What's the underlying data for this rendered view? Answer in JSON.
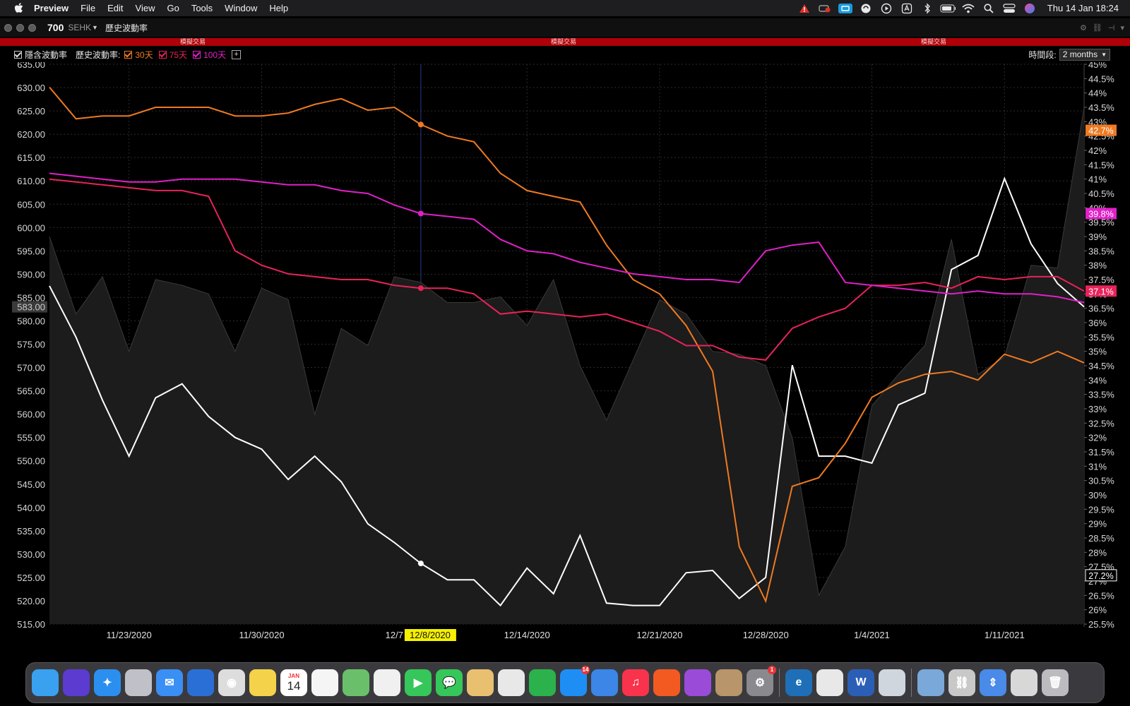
{
  "menubar": {
    "app_name": "Preview",
    "items": [
      "File",
      "Edit",
      "View",
      "Go",
      "Tools",
      "Window",
      "Help"
    ],
    "status_icons": [
      "warning-icon",
      "battery-status-icon",
      "screen-mirror-icon",
      "sync-icon",
      "play-icon",
      "app-store-icon",
      "bluetooth-icon",
      "battery-icon",
      "wifi-icon",
      "search-icon",
      "control-center-icon",
      "siri-icon"
    ],
    "clock": "Thu 14 Jan  18:24"
  },
  "window": {
    "symbol": "700",
    "exchange": "SEHK",
    "panel_title": "歷史波動率",
    "banner_label": "模擬交易"
  },
  "toolbar": {
    "implied_vol_label": "隱含波動率",
    "historical_vol_label": "歷史波動率:",
    "vol_30_label": "30天",
    "vol_75_label": "75天",
    "vol_100_label": "100天",
    "plus_label": "+",
    "period_label": "時間段:",
    "period_value": "2 months"
  },
  "colors": {
    "price": "#ffffff",
    "vol30": "#ee7a22",
    "vol75": "#e8235a",
    "vol100": "#e020c8",
    "implied": "#8a8a8a",
    "crosshair_date_bg": "#f5f000"
  },
  "chart_data": {
    "type": "line",
    "x_tick_labels": [
      "11/23/2020",
      "11/30/2020",
      "12/7",
      "12/14/2020",
      "12/21/2020",
      "12/28/2020",
      "1/4/2021",
      "1/11/2021"
    ],
    "crosshair_date": "12/8/2020",
    "left_axis": {
      "ylim": [
        515,
        635
      ],
      "tick_labels": [
        "635.00",
        "630.00",
        "625.00",
        "620.00",
        "615.00",
        "610.00",
        "605.00",
        "600.00",
        "595.00",
        "590.00",
        "585.00",
        "580.00",
        "575.00",
        "570.00",
        "565.00",
        "560.00",
        "555.00",
        "550.00",
        "545.00",
        "540.00",
        "535.00",
        "530.00",
        "525.00",
        "520.00",
        "515.00"
      ],
      "current_label": "583.00"
    },
    "right_axis": {
      "ylim": [
        25.5,
        45
      ],
      "tick_labels": [
        "45%",
        "44.5%",
        "44%",
        "43.5%",
        "43%",
        "42.5%",
        "42%",
        "41.5%",
        "41%",
        "40.5%",
        "40%",
        "39.5%",
        "39%",
        "38.5%",
        "38%",
        "37.5%",
        "37%",
        "36.5%",
        "36%",
        "35.5%",
        "35%",
        "34.5%",
        "34%",
        "33.5%",
        "33%",
        "32.5%",
        "32%",
        "31.5%",
        "31%",
        "30.5%",
        "30%",
        "29.5%",
        "29%",
        "28.5%",
        "28%",
        "27.5%",
        "27%",
        "26.5%",
        "26%",
        "25.5%"
      ]
    },
    "dates": [
      "11/18",
      "11/19",
      "11/20",
      "11/23",
      "11/24",
      "11/25",
      "11/26",
      "11/27",
      "11/30",
      "12/1",
      "12/2",
      "12/3",
      "12/4",
      "12/7",
      "12/8",
      "12/9",
      "12/10",
      "12/11",
      "12/14",
      "12/15",
      "12/16",
      "12/17",
      "12/18",
      "12/21",
      "12/22",
      "12/23",
      "12/24",
      "12/28",
      "12/29",
      "12/30",
      "12/31",
      "1/4",
      "1/5",
      "1/6",
      "1/7",
      "1/8",
      "1/11",
      "1/12",
      "1/13",
      "1/14"
    ],
    "series": [
      {
        "name": "price",
        "axis": "left",
        "color_key": "price",
        "end_label": "27.2%",
        "values": [
          587.5,
          576.5,
          563.0,
          551.0,
          563.5,
          566.5,
          559.5,
          555.0,
          552.5,
          546.0,
          551.0,
          545.5,
          536.5,
          532.5,
          528.0,
          524.5,
          524.5,
          519.0,
          527.0,
          521.5,
          534.0,
          519.5,
          519.0,
          519.0,
          526.0,
          526.5,
          520.5,
          525.0,
          570.5,
          551.0,
          551.0,
          549.5,
          562.0,
          564.5,
          591.0,
          594.0,
          610.5,
          596.5,
          588.0,
          583.0
        ]
      },
      {
        "name": "30天",
        "axis": "right",
        "color_key": "vol30",
        "end_label": "42.7%",
        "values": [
          44.2,
          43.1,
          43.2,
          43.2,
          43.5,
          43.5,
          43.5,
          43.2,
          43.2,
          43.3,
          43.6,
          43.8,
          43.4,
          43.5,
          42.9,
          42.5,
          42.3,
          41.2,
          40.6,
          40.4,
          40.2,
          38.7,
          37.5,
          37.0,
          35.9,
          34.3,
          28.2,
          26.3,
          30.3,
          30.6,
          31.8,
          33.4,
          33.9,
          34.2,
          34.3,
          34.0,
          34.9,
          34.6,
          35.0,
          34.6
        ]
      },
      {
        "name": "75天",
        "axis": "right",
        "color_key": "vol75",
        "end_label": "37.1%",
        "values": [
          41.0,
          40.9,
          40.8,
          40.7,
          40.6,
          40.6,
          40.4,
          38.5,
          38.0,
          37.7,
          37.6,
          37.5,
          37.5,
          37.3,
          37.2,
          37.2,
          37.0,
          36.3,
          36.4,
          36.3,
          36.2,
          36.3,
          36.0,
          35.7,
          35.2,
          35.2,
          34.8,
          34.7,
          35.8,
          36.2,
          36.5,
          37.3,
          37.3,
          37.4,
          37.2,
          37.6,
          37.5,
          37.6,
          37.6,
          37.1
        ]
      },
      {
        "name": "100天",
        "axis": "right",
        "color_key": "vol100",
        "end_label": "39.8%",
        "values": [
          41.2,
          41.1,
          41.0,
          40.9,
          40.9,
          41.0,
          41.0,
          41.0,
          40.9,
          40.8,
          40.8,
          40.6,
          40.5,
          40.1,
          39.8,
          39.7,
          39.6,
          38.9,
          38.5,
          38.4,
          38.1,
          37.9,
          37.7,
          37.6,
          37.5,
          37.5,
          37.4,
          38.5,
          38.7,
          38.8,
          37.4,
          37.3,
          37.2,
          37.1,
          37.0,
          37.1,
          37.0,
          37.0,
          36.9,
          36.7
        ]
      },
      {
        "name": "隱含波動率",
        "axis": "right",
        "color_key": "implied",
        "values": [
          39.0,
          36.3,
          37.6,
          35.0,
          37.5,
          37.3,
          37.0,
          35.0,
          37.2,
          36.8,
          32.8,
          35.8,
          35.2,
          37.6,
          37.4,
          36.7,
          36.7,
          36.9,
          35.9,
          37.5,
          34.5,
          32.6,
          34.7,
          36.8,
          36.3,
          35.0,
          34.9,
          34.5,
          32.0,
          26.5,
          28.2,
          33.1,
          34.2,
          35.2,
          38.9,
          34.2,
          34.8,
          38.0,
          37.9,
          43.5
        ]
      }
    ]
  },
  "dock": {
    "apps": [
      "finder-icon",
      "siri-icon",
      "safari-icon",
      "launchpad-icon",
      "mail-icon",
      "airdrop-icon",
      "chrome-icon",
      "notes-icon",
      "calendar-icon",
      "reminders-icon",
      "maps-icon",
      "photos-icon",
      "facetime-icon",
      "messages-icon",
      "preview-icon",
      "trader-icon",
      "numbers-icon",
      "appstore-icon",
      "keynote-icon",
      "music-icon",
      "brave-icon",
      "podcasts-icon",
      "contacts-icon",
      "settings-icon"
    ],
    "apps_right": [
      "edge-icon",
      "textedit-icon",
      "word-icon",
      "screenshot-icon"
    ],
    "stacks": [
      "folder-icon",
      "link-icon",
      "updown-icon",
      "keyboard-icon",
      "trash-icon"
    ],
    "calendar_month": "JAN",
    "calendar_day": "14",
    "appstore_badge": "14",
    "settings_badge": "1"
  }
}
